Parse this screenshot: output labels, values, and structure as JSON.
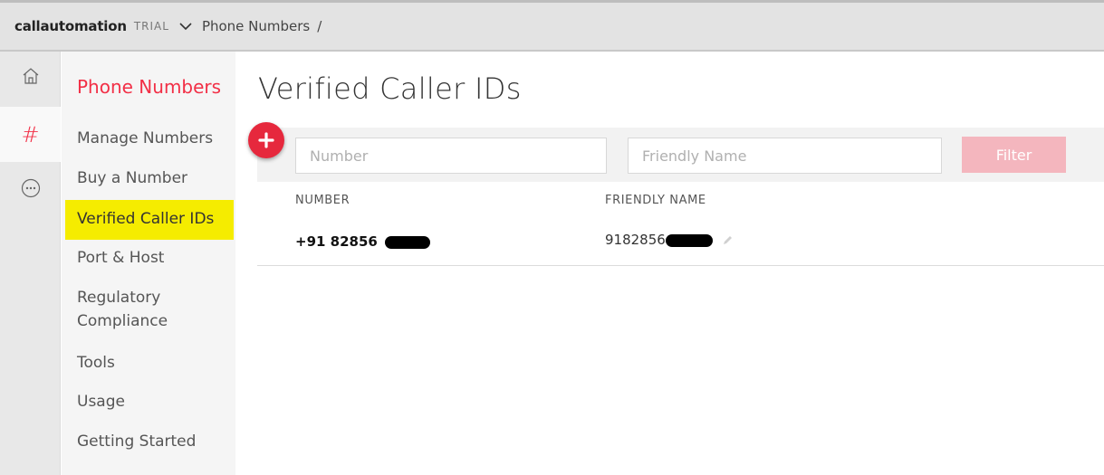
{
  "topbar": {
    "account": "callautomation",
    "badge": "TRIAL",
    "breadcrumb": "Phone Numbers",
    "separator": "/"
  },
  "rail": {
    "icons": [
      "home-icon",
      "hash-icon",
      "more-icon"
    ],
    "hash_glyph": "#",
    "accent": "#f22f46"
  },
  "sidenav": {
    "title": "Phone Numbers",
    "items": [
      {
        "label": "Manage Numbers"
      },
      {
        "label": "Buy a Number"
      },
      {
        "label": "Verified Caller IDs",
        "active": true
      },
      {
        "label": "Port & Host"
      },
      {
        "label": "Regulatory"
      },
      {
        "label": "Compliance"
      },
      {
        "label": "Tools"
      },
      {
        "label": "Usage"
      },
      {
        "label": "Getting Started"
      }
    ],
    "highlight_color": "#f5ec00"
  },
  "main": {
    "title": "Verified Caller IDs",
    "filters": {
      "number_placeholder": "Number",
      "friendly_placeholder": "Friendly Name",
      "filter_label": "Filter"
    },
    "table": {
      "columns": [
        "NUMBER",
        "FRIENDLY NAME"
      ],
      "rows": [
        {
          "number": "+91 82856",
          "friendly_name": "9182856"
        }
      ]
    }
  }
}
